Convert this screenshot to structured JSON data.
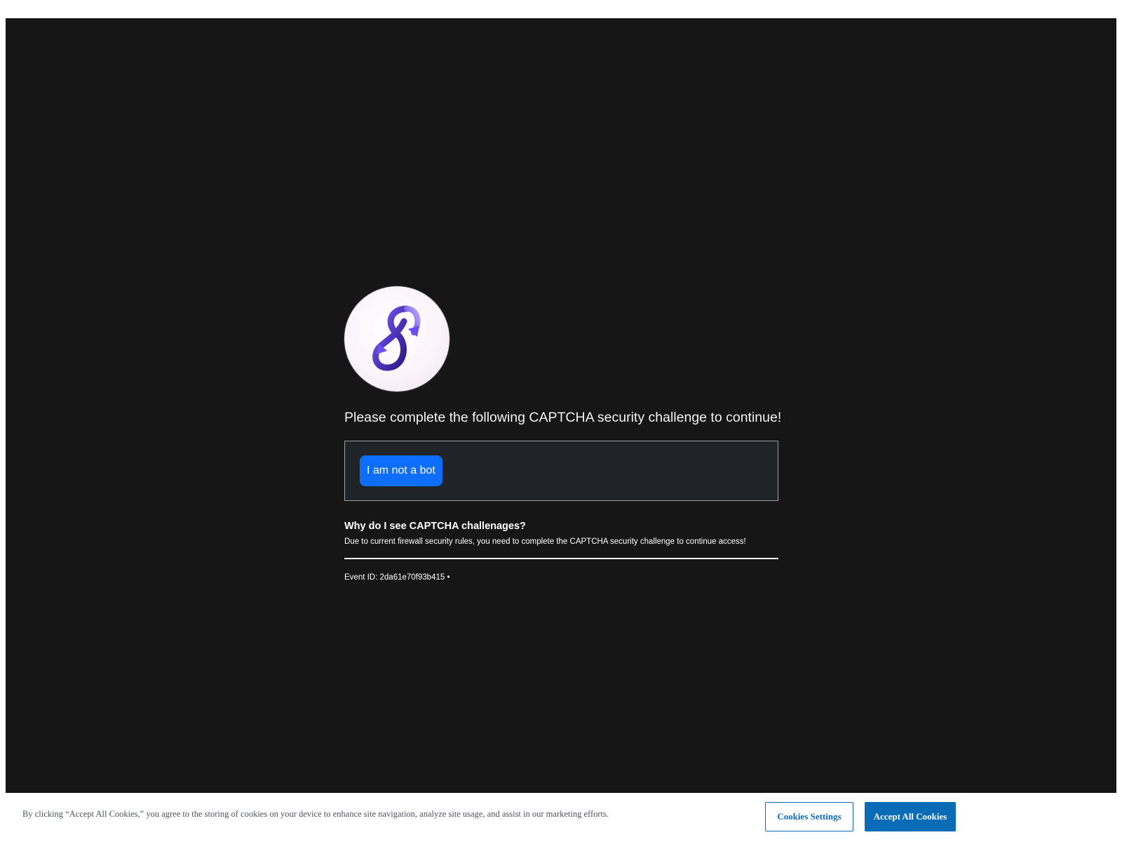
{
  "challenge": {
    "logo_icon": "infinity-arrows-logo-icon",
    "headline": "Please complete the following CAPTCHA security challenge to continue!",
    "button_label": "I am not a bot",
    "why_title": "Why do I see CAPTCHA challenages?",
    "why_text": "Due to current firewall security rules, you need to complete the CAPTCHA security challenge to continue access!",
    "event_label": "Event ID:",
    "event_id": "2da61e70f93b415",
    "event_separator": "•"
  },
  "cookie_banner": {
    "text": "By clicking “Accept All Cookies,” you agree to the storing of cookies on your device to enhance site navigation, analyze site usage, and assist in our marketing efforts.",
    "settings_label": "Cookies Settings",
    "accept_label": "Accept All Cookies"
  },
  "colors": {
    "panel_background": "#161617",
    "captcha_box_background": "#202327",
    "primary_button": "#0d6efd",
    "cookie_button": "#0a6bb7",
    "logo_purple": "#5b3fd0"
  }
}
